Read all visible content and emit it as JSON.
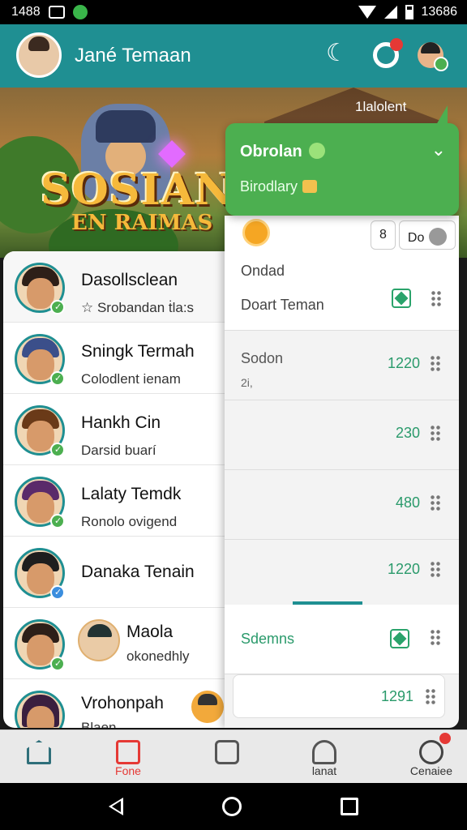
{
  "statusbar": {
    "time": "1488",
    "right": "13686"
  },
  "header": {
    "title": "Jané Temaan"
  },
  "banner": {
    "logo_line1": "SOSIANI",
    "logo_line2": "EN RAIMAS",
    "label": "1lalolent"
  },
  "popup": {
    "title": "Obrolan",
    "subtitle": "Birodlary"
  },
  "panel": {
    "tab1": "8",
    "tab2": "Do",
    "online_label": "Ondad",
    "friend_label": "Doart Teman",
    "rows": [
      {
        "label": "Sodon",
        "sub": "2i,",
        "value": "1220"
      },
      {
        "label": "",
        "sub": "",
        "value": "230"
      },
      {
        "label": "",
        "sub": "",
        "value": "480"
      },
      {
        "label": "",
        "sub": "",
        "value": "1220"
      }
    ],
    "settings_label": "Sdemns",
    "last_value": "1291"
  },
  "contacts": [
    {
      "name": "Dasollsclean",
      "sub": "☆ Srobandan ṫla:s"
    },
    {
      "name": "Sningk Termah",
      "sub": "Colodlent ienam"
    },
    {
      "name": "Hankh Cin",
      "sub": "Darsid buarí"
    },
    {
      "name": "Lalaty Temdk",
      "sub": "Ronolo ovigend"
    },
    {
      "name": "Danaka Tenain",
      "sub": ""
    },
    {
      "name": "Maola",
      "sub": "okonedhly"
    },
    {
      "name": "Vrohonpah",
      "sub": "Blaen"
    }
  ],
  "bottom_nav": [
    {
      "label": ""
    },
    {
      "label": "Fone"
    },
    {
      "label": ""
    },
    {
      "label": "lanat"
    },
    {
      "label": "Cenaiee"
    }
  ],
  "colors": {
    "teal": "#1f8f92",
    "green": "#4caf50",
    "accent_red": "#e53935"
  }
}
